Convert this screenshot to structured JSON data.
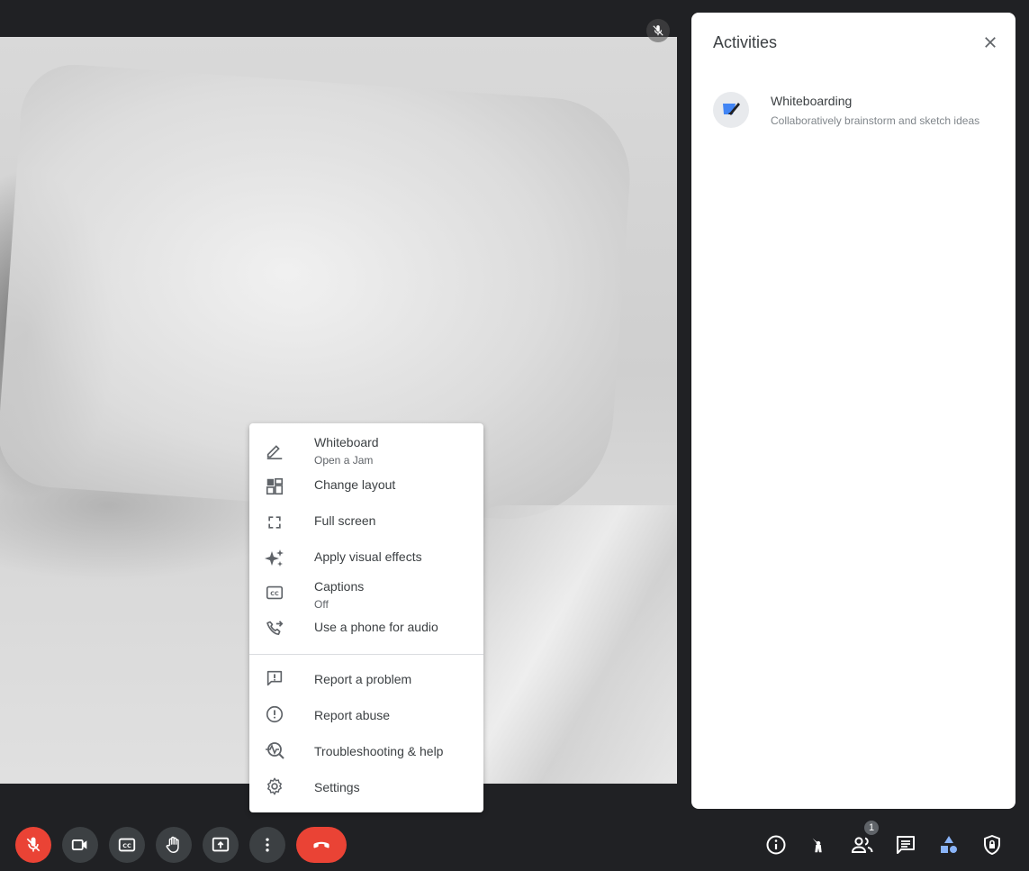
{
  "activities_panel": {
    "title": "Activities",
    "items": [
      {
        "name": "Whiteboarding",
        "description": "Collaboratively brainstorm and sketch ideas",
        "icon": "jamboard-icon"
      }
    ]
  },
  "more_options_menu": {
    "items": [
      {
        "label": "Whiteboard",
        "sublabel": "Open a Jam",
        "icon": "pencil-icon"
      },
      {
        "label": "Change layout",
        "icon": "layout-icon"
      },
      {
        "label": "Full screen",
        "icon": "fullscreen-icon"
      },
      {
        "label": "Apply visual effects",
        "icon": "sparkle-icon"
      },
      {
        "label": "Captions",
        "sublabel": "Off",
        "icon": "captions-icon"
      },
      {
        "label": "Use a phone for audio",
        "icon": "phone-forward-icon"
      },
      {
        "label": "Report a problem",
        "icon": "feedback-icon"
      },
      {
        "label": "Report abuse",
        "icon": "alert-icon"
      },
      {
        "label": "Troubleshooting & help",
        "icon": "troubleshoot-icon"
      },
      {
        "label": "Settings",
        "icon": "gear-icon"
      }
    ]
  },
  "toolbar": {
    "participants_count": "1",
    "colors": {
      "danger": "#ea4335",
      "button_bg": "#3c4043",
      "accent": "#8ab4f8"
    }
  }
}
